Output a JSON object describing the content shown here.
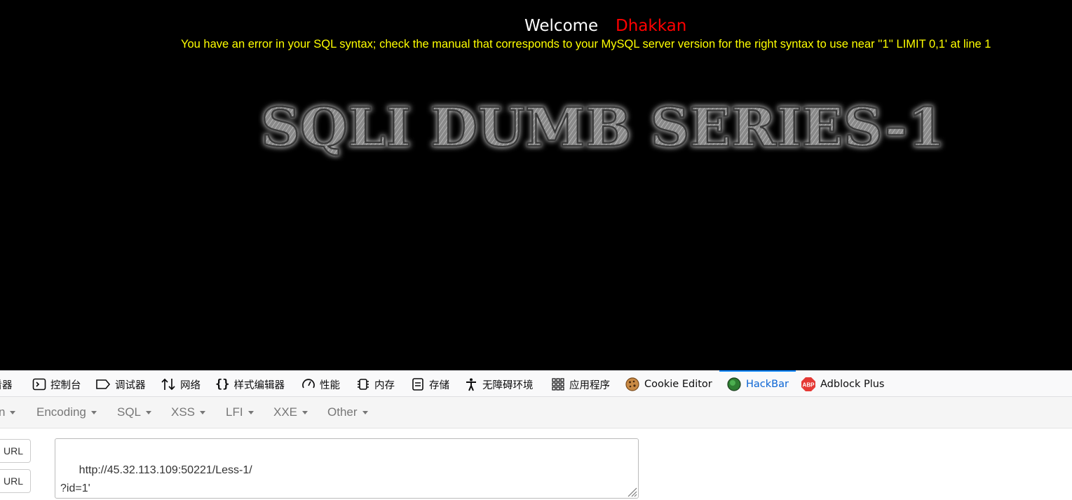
{
  "page": {
    "welcome": "Welcome",
    "name": "Dhakkan",
    "error": "You have an error in your SQL syntax; check the manual that corresponds to your MySQL server version for the right syntax to use near ''1'' LIMIT 0,1' at line 1",
    "banner": "SQLI DUMB SERIES-1"
  },
  "devtools": {
    "tabs": {
      "inspector": "查看器",
      "console": "控制台",
      "debugger": "调试器",
      "network": "网络",
      "style_editor": "样式编辑器",
      "performance": "性能",
      "memory": "内存",
      "storage": "存储",
      "accessibility": "无障碍环境",
      "application": "应用程序",
      "cookie_editor": "Cookie Editor",
      "hackbar": "HackBar",
      "adblock": "Adblock Plus"
    },
    "active_tab": "HackBar"
  },
  "hackbar": {
    "menu": {
      "first_partial": "n",
      "encoding": "Encoding",
      "sql": "SQL",
      "xss": "XSS",
      "lfi": "LFI",
      "xxe": "XXE",
      "other": "Other"
    },
    "buttons": {
      "load_url": "URL",
      "split_url": "URL"
    },
    "url_value": "http://45.32.113.109:50221/Less-1/\n?id=1'"
  },
  "colors": {
    "page_bg": "#000000",
    "welcome": "#ffffff",
    "name": "#ff0000",
    "error": "#ffff00",
    "active_tab": "#0a64d4"
  }
}
